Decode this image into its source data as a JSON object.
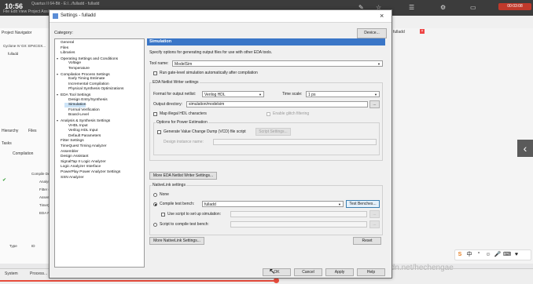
{
  "ide": {
    "clock": "10:56",
    "title": "Quartus II 64-Bit - E:/.../fulladd - fulladd",
    "menu": "File  Edit  View  Project  Assignments  Processing  Tools  Window  Help",
    "project_navigator": "Project Navigator",
    "device": "Cyclone IV GX: EP4CGX...",
    "top_entity": "fulladd",
    "hierarchy_tab": "Hierarchy",
    "files_tab": "Files",
    "tasks_label": "Tasks",
    "compilation_label": "Compilation",
    "task_rows": [
      "Compile Design",
      "Analysis & ...",
      "Fitter (Pl...",
      "Assembler...",
      "TimeQuest...",
      "EDA Netli..."
    ],
    "type_col": "Type",
    "id_col": "ID",
    "fulladd_tab": "fulladd",
    "taskbar_items": [
      "System",
      "Process..."
    ],
    "watermark": "http://blog.csdn.net/hechengae",
    "record_label": "00:03:08"
  },
  "dialog": {
    "title": "Settings - fulladd",
    "category_label": "Category:",
    "device_button": "Device...",
    "tree": [
      {
        "label": "General",
        "level": 0
      },
      {
        "label": "Files",
        "level": 0
      },
      {
        "label": "Libraries",
        "level": 0
      },
      {
        "label": "Operating Settings and Conditions",
        "level": 0,
        "expander": true
      },
      {
        "label": "Voltage",
        "level": 1
      },
      {
        "label": "Temperature",
        "level": 1
      },
      {
        "label": "Compilation Process Settings",
        "level": 0,
        "expander": true
      },
      {
        "label": "Early Timing Estimate",
        "level": 1
      },
      {
        "label": "Incremental Compilation",
        "level": 1
      },
      {
        "label": "Physical Synthesis Optimizations",
        "level": 1
      },
      {
        "label": "EDA Tool Settings",
        "level": 0,
        "expander": true
      },
      {
        "label": "Design Entry/Synthesis",
        "level": 1
      },
      {
        "label": "Simulation",
        "level": 1,
        "selected": true
      },
      {
        "label": "Formal Verification",
        "level": 1
      },
      {
        "label": "Board-Level",
        "level": 1
      },
      {
        "label": "Analysis & Synthesis Settings",
        "level": 0,
        "expander": true
      },
      {
        "label": "VHDL Input",
        "level": 1
      },
      {
        "label": "Verilog HDL Input",
        "level": 1
      },
      {
        "label": "Default Parameters",
        "level": 1
      },
      {
        "label": "Fitter Settings",
        "level": 0
      },
      {
        "label": "TimeQuest Timing Analyzer",
        "level": 0
      },
      {
        "label": "Assembler",
        "level": 0
      },
      {
        "label": "Design Assistant",
        "level": 0
      },
      {
        "label": "SignalTap II Logic Analyzer",
        "level": 0
      },
      {
        "label": "Logic Analyzer Interface",
        "level": 0
      },
      {
        "label": "PowerPlay Power Analyzer Settings",
        "level": 0
      },
      {
        "label": "SSN Analyzer",
        "level": 0
      }
    ],
    "panel": {
      "header": "Simulation",
      "description": "Specify options for generating output files for use with other EDA tools.",
      "tool_name_label": "Tool name:",
      "tool_name_value": "ModelSim",
      "run_gate_level": "Run gate-level simulation automatically after compilation",
      "eda_netlist_group": "EDA Netlist Writer settings",
      "format_label": "Format for output netlist:",
      "format_value": "Verilog HDL",
      "time_scale_label": "Time scale:",
      "time_scale_value": "1 ps",
      "output_dir_label": "Output directory:",
      "output_dir_value": "simulation/modelsim",
      "browse_label": "...",
      "map_illegal": "Map illegal HDL characters",
      "enable_glitch": "Enable glitch filtering",
      "power_group": "Options for Power Estimation",
      "generate_vcd": "Generate Value Change Dump (VCD) file script",
      "script_settings_button": "Script Settings...",
      "design_instance_label": "Design instance name:",
      "more_eda_button": "More EDA Netlist Writer Settings...",
      "nativelink_group": "NativeLink settings",
      "none_label": "None",
      "compile_tb_label": "Compile test bench:",
      "compile_tb_value": "fulladd",
      "test_benches_button": "Test Benches...",
      "use_script_label": "Use script to set up simulation:",
      "script_compile_label": "Script to compile test bench:",
      "more_nativelink_button": "More NativeLink Settings...",
      "reset_button": "Reset"
    },
    "footer": {
      "ok": "OK",
      "cancel": "Cancel",
      "apply": "Apply",
      "help": "Help"
    }
  },
  "colors": {
    "panel_header": "#3a76c7",
    "selection": "#cde4f7",
    "progress": "#e74c3c"
  }
}
